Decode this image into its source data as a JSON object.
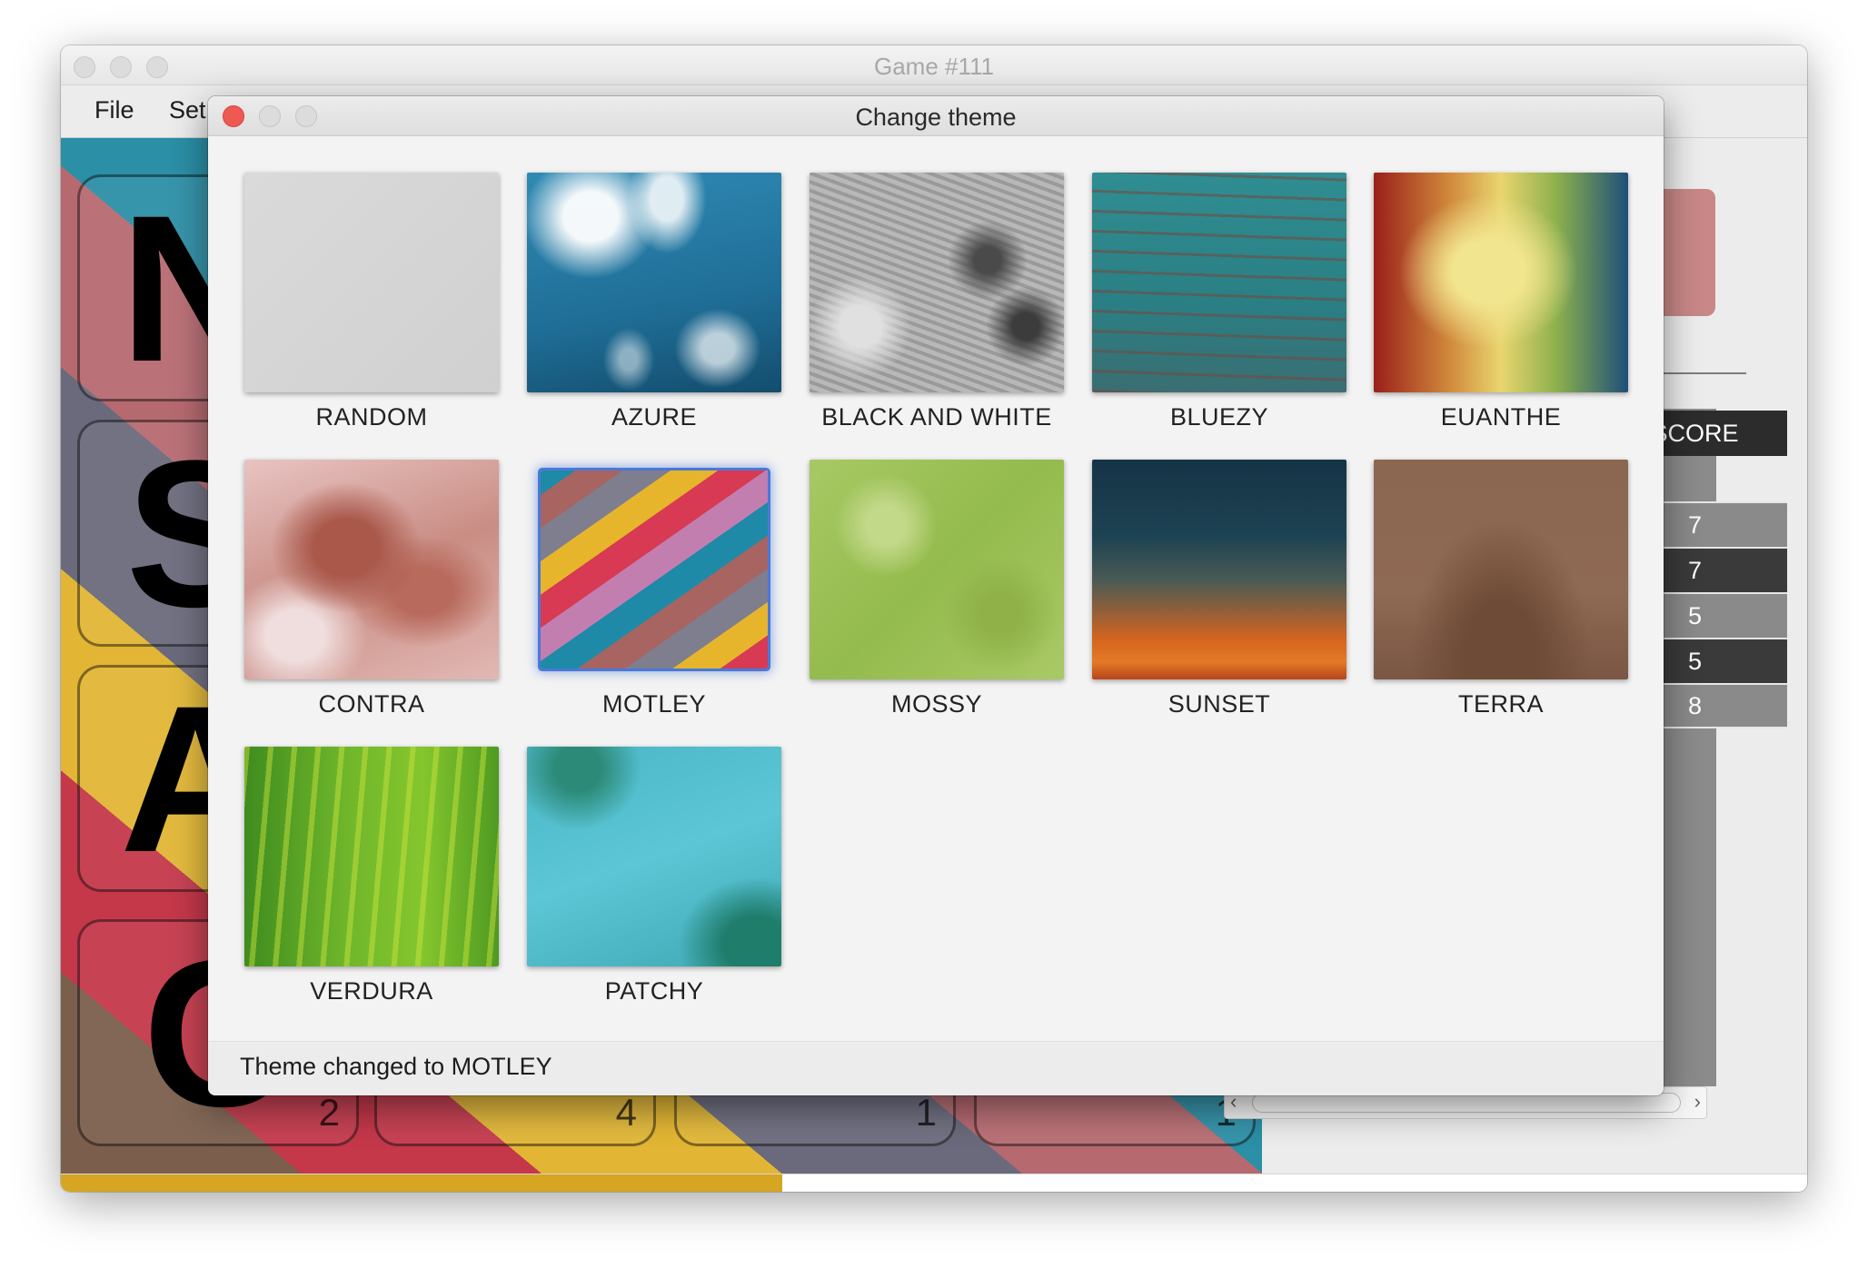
{
  "main_window": {
    "title": "Game #111",
    "menu": [
      "File",
      "Set"
    ]
  },
  "board": {
    "tiles": [
      {
        "letter": "N",
        "points": ""
      },
      {
        "letter": "S",
        "points": ""
      },
      {
        "letter": "A",
        "points": ""
      },
      {
        "letter": "C",
        "points": "2"
      }
    ],
    "bottom_tile_points": [
      "4",
      "1",
      "1"
    ]
  },
  "score_panel": {
    "header": "SCORE",
    "scores": [
      "7",
      "7",
      "5",
      "5",
      "8"
    ]
  },
  "progress": {
    "fraction": 0.413,
    "color": "#d6a521"
  },
  "dialog": {
    "title": "Change theme",
    "selected": "MOTLEY",
    "status": "Theme changed to MOTLEY",
    "themes": [
      {
        "label": "RANDOM"
      },
      {
        "label": "AZURE"
      },
      {
        "label": "BLACK AND WHITE"
      },
      {
        "label": "BLUEZY"
      },
      {
        "label": "EUANTHE"
      },
      {
        "label": "CONTRA"
      },
      {
        "label": "MOTLEY"
      },
      {
        "label": "MOSSY"
      },
      {
        "label": "SUNSET"
      },
      {
        "label": "TERRA"
      },
      {
        "label": "VERDURA"
      },
      {
        "label": "PATCHY"
      }
    ]
  },
  "colors": {
    "close_button": "#ee5a52",
    "selection_glow": "#4a78d8",
    "score_header_bg": "#2c2c2c"
  }
}
